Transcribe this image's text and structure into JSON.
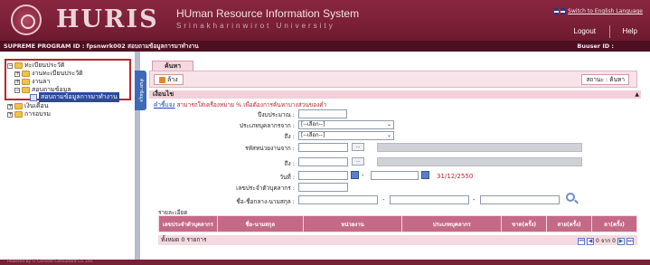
{
  "header": {
    "brand": "HURIS",
    "system_title": "HUman Resource Information System",
    "system_subtitle": "Srinakharinwirot University",
    "lang_link": "Switch to English Language",
    "logout": "Logout",
    "help": "Help"
  },
  "infobar": {
    "left": "SUPREME  PROGRAM ID : fpsnwrk002 สอบถามข้อมูลการมาทำงาน",
    "right": "Buuser ID :"
  },
  "tree": {
    "items": [
      {
        "label": "ทะเบียนประวัติ",
        "toggle": "−"
      },
      {
        "label": "งานทะเบียนประวัติ",
        "toggle": "+"
      },
      {
        "label": "งานลา",
        "toggle": "+"
      },
      {
        "label": "สอบถามข้อมูล",
        "toggle": "−"
      },
      {
        "label": "สอบถามข้อมูลการมาทำงาน",
        "toggle": ""
      },
      {
        "label": "เงินเดือน",
        "toggle": "+"
      },
      {
        "label": "การอบรม",
        "toggle": "+"
      }
    ]
  },
  "side_tab": "ค้นหาข้อมูล",
  "toolbar": {
    "tab": "ค้นหา",
    "back": "ล้าง",
    "status": "สถานะ :  ค้นหา"
  },
  "form": {
    "section": "เงื่อนไข",
    "hint_link": "คำชี้แจง",
    "hint_text": " สามารถใส่เครื่องหมาย % เพื่อต้องการค้นหาบางส่วนของคำ",
    "budget_year_label": "ปีงบประมาณ :",
    "staff_type_label": "ประเภทบุคลากรจาก :",
    "staff_type_from": "[--เลือก--]",
    "staff_type_to_label": "ถึง :",
    "staff_type_to": "[--เลือก--]",
    "unit_from_label": "รหัสหน่วยงานจาก :",
    "unit_to_label": "ถึง :",
    "date_label": "วันที่ :",
    "today": "31/12/2550",
    "id_label": "เลขประจำตัวบุคลากร :",
    "name_label": "ชื่อ-ชื่อกลาง-นามสกุล :",
    "dash": "-",
    "browse": "..."
  },
  "results": {
    "label": "รายละเอียด",
    "columns": [
      "เลขประจำตัวบุคลากร",
      "ชื่อ-นามสกุล",
      "หน่วยงาน",
      "ประเภทบุคลากร",
      "ขาด(ครั้ง)",
      "สาย(ครั้ง)",
      "ลา(ครั้ง)"
    ],
    "total": "ทั้งหมด  0  รายการ",
    "pager_text": "0 จาก 0"
  },
  "footer": "Powered by IT Console Consultant Co.,Ltd."
}
